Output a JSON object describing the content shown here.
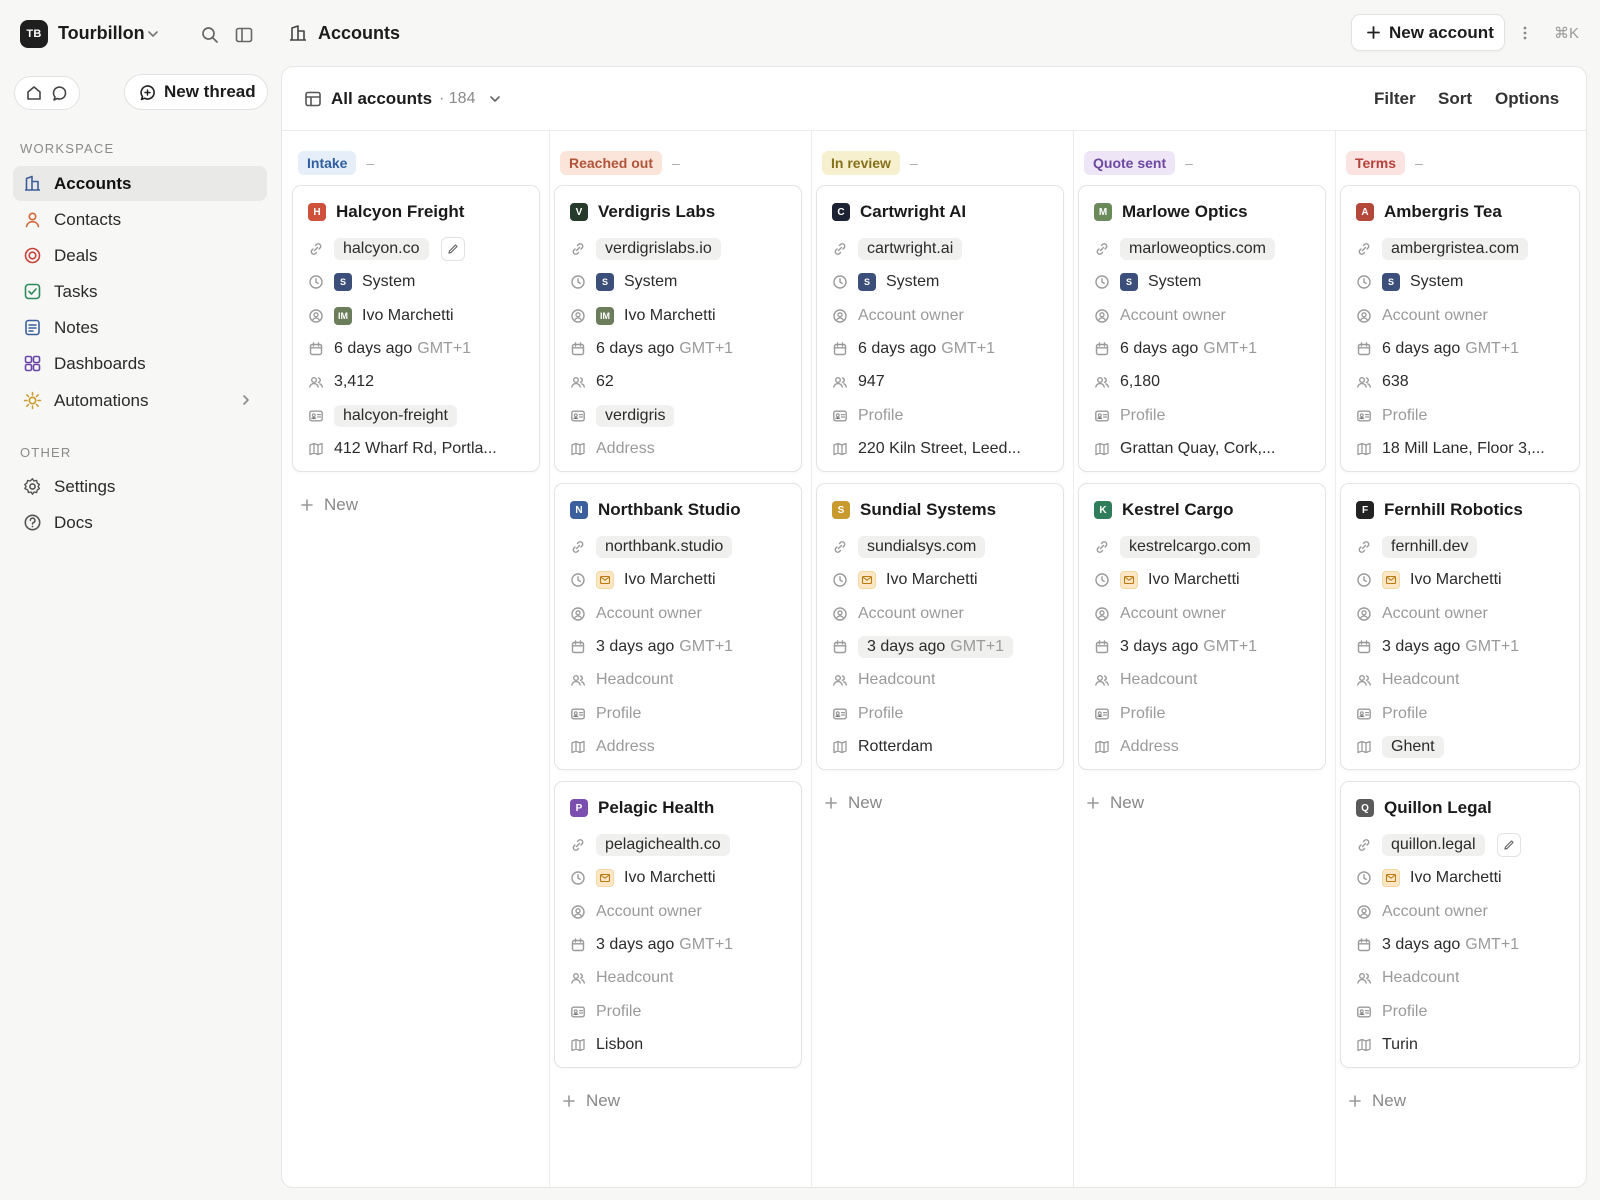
{
  "workspace": {
    "initials": "TB",
    "name": "Tourbillon"
  },
  "breadcrumb": {
    "title": "Accounts"
  },
  "toolbar": {
    "new_account": "New account",
    "shortcut": "⌘K"
  },
  "sidebar": {
    "new_thread": "New thread",
    "workspace_label": "WORKSPACE",
    "other_label": "OTHER",
    "items": [
      {
        "label": "Accounts",
        "icon": "accounts-icon",
        "active": true
      },
      {
        "label": "Contacts",
        "icon": "person-icon"
      },
      {
        "label": "Deals",
        "icon": "target-icon"
      },
      {
        "label": "Tasks",
        "icon": "checkbox-icon"
      },
      {
        "label": "Notes",
        "icon": "note-icon"
      },
      {
        "label": "Dashboards",
        "icon": "grid-icon"
      },
      {
        "label": "Automations",
        "icon": "sun-icon"
      }
    ],
    "other_items": [
      {
        "label": "Settings",
        "icon": "gear-icon"
      },
      {
        "label": "Docs",
        "icon": "help-icon"
      }
    ]
  },
  "view": {
    "title": "All accounts",
    "count": "· 184",
    "filter": "Filter",
    "sort": "Sort",
    "options": "Options"
  },
  "add_new_label": "New",
  "columns": [
    {
      "label": "Intake",
      "color": "#e5eef9",
      "text": "#2f5fa0",
      "dash": "–",
      "cards": [
        {
          "name": "Halcyon Freight",
          "logo": "H",
          "logo_color": "#d0513b",
          "domain": "halcyon.co",
          "edit": true,
          "source": "System",
          "source_avatar": "S",
          "owner": "Ivo Marchetti",
          "owner_avatar": "IM",
          "date": "6 days ago",
          "tz": "GMT+1",
          "headcount": "3,412",
          "profile": "halcyon-freight",
          "address": "412 Wharf Rd, Portla..."
        }
      ]
    },
    {
      "label": "Reached out",
      "color": "#fbe5da",
      "text": "#b0553a",
      "dash": "–",
      "cards": [
        {
          "name": "Verdigris Labs",
          "logo": "V",
          "logo_color": "#253a2b",
          "domain": "verdigrislabs.io",
          "source": "System",
          "source_avatar": "S",
          "owner": "Ivo Marchetti",
          "owner_avatar": "IM",
          "date": "6 days ago",
          "tz": "GMT+1",
          "headcount": "62",
          "profile": "verdigris",
          "address": ""
        },
        {
          "name": "Northbank Studio",
          "logo": "N",
          "logo_color": "#3b5f9c",
          "domain": "northbank.studio",
          "source": "Ivo Marchetti",
          "source_mail": true,
          "owner": "",
          "date": "3 days ago",
          "tz": "GMT+1",
          "headcount": "",
          "profile": "",
          "address": ""
        },
        {
          "name": "Pelagic Health",
          "logo": "P",
          "logo_color": "#7b4fb0",
          "domain": "pelagichealth.co",
          "source": "Ivo Marchetti",
          "source_mail": true,
          "owner": "",
          "date": "3 days ago",
          "tz": "GMT+1",
          "headcount": "",
          "profile": "",
          "address": "Lisbon"
        }
      ]
    },
    {
      "label": "In review",
      "color": "#f6f0cf",
      "text": "#86701a",
      "dash": "–",
      "cards": [
        {
          "name": "Cartwright AI",
          "logo": "C",
          "logo_color": "#1d2233",
          "domain": "cartwright.ai",
          "source": "System",
          "source_avatar": "S",
          "owner": "",
          "date": "6 days ago",
          "tz": "GMT+1",
          "headcount": "947",
          "profile": "",
          "address": "220 Kiln Street, Leed..."
        },
        {
          "name": "Sundial Systems",
          "logo": "S",
          "logo_color": "#c99a2e",
          "domain": "sundialsys.com",
          "source": "Ivo Marchetti",
          "source_mail": true,
          "owner": "",
          "date": "3 days ago",
          "tz": "GMT+1",
          "date_chip": true,
          "headcount": "",
          "profile": "",
          "address": "Rotterdam"
        }
      ]
    },
    {
      "label": "Quote sent",
      "color": "#eee6f7",
      "text": "#6c48a0",
      "dash": "–",
      "cards": [
        {
          "name": "Marlowe Optics",
          "logo": "M",
          "logo_color": "#6b8a5a",
          "domain": "marloweoptics.com",
          "source": "System",
          "source_avatar": "S",
          "owner": "",
          "date": "6 days ago",
          "tz": "GMT+1",
          "headcount": "6,180",
          "profile": "",
          "address": "Grattan Quay, Cork,..."
        },
        {
          "name": "Kestrel Cargo",
          "logo": "K",
          "logo_color": "#2f7d5a",
          "domain": "kestrelcargo.com",
          "source": "Ivo Marchetti",
          "source_mail": true,
          "owner": "",
          "date": "3 days ago",
          "tz": "GMT+1",
          "headcount": "",
          "profile": "",
          "address": ""
        }
      ]
    },
    {
      "label": "Terms",
      "color": "#fbe3e1",
      "text": "#b5413a",
      "dash": "–",
      "cards": [
        {
          "name": "Ambergris Tea",
          "logo": "A",
          "logo_color": "#b3473a",
          "domain": "ambergristea.com",
          "source": "System",
          "source_avatar": "S",
          "owner": "",
          "date": "6 days ago",
          "tz": "GMT+1",
          "headcount": "638",
          "profile": "",
          "address": "18 Mill Lane, Floor 3,..."
        },
        {
          "name": "Fernhill Robotics",
          "logo": "F",
          "logo_color": "#222222",
          "domain": "fernhill.dev",
          "source": "Ivo Marchetti",
          "source_mail": true,
          "owner": "",
          "date": "3 days ago",
          "tz": "GMT+1",
          "headcount": "",
          "profile": "",
          "address": "Ghent",
          "address_chip": true
        },
        {
          "name": "Quillon Legal",
          "logo": "Q",
          "logo_color": "#5a5a5a",
          "domain": "quillon.legal",
          "edit": true,
          "source": "Ivo Marchetti",
          "source_mail": true,
          "owner": "",
          "date": "3 days ago",
          "tz": "GMT+1",
          "headcount": "",
          "profile": "",
          "address": "Turin"
        }
      ]
    }
  ],
  "placeholders": {
    "owner": "Account owner",
    "headcount": "Headcount",
    "profile": "Profile",
    "address": "Address"
  }
}
